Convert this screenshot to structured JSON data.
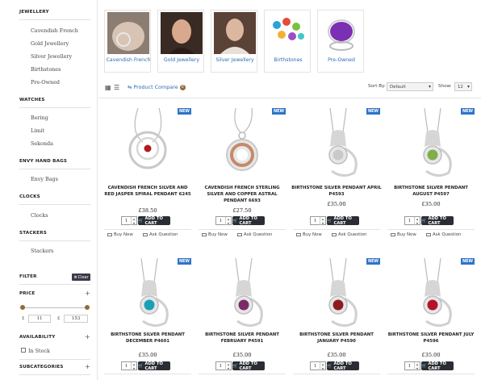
{
  "sidebar": {
    "jewellery": {
      "heading": "JEWELLERY",
      "items": [
        "Cavendish French",
        "Gold Jewellery",
        "Silver Jewellery",
        "Birthstones",
        "Pre-Owned"
      ]
    },
    "watches": {
      "heading": "WATCHES",
      "items": [
        "Bering",
        "Limit",
        "Sekonda"
      ]
    },
    "envy": {
      "heading": "ENVY HAND BAGS",
      "items": [
        "Envy Bags"
      ]
    },
    "clocks": {
      "heading": "CLOCKS",
      "items": [
        "Clocks"
      ]
    },
    "stackers": {
      "heading": "STACKERS",
      "items": [
        "Stackers"
      ]
    },
    "filter": {
      "heading": "FILTER",
      "clear": "Clear"
    },
    "price": {
      "heading": "PRICE",
      "currency": "£",
      "min": "11",
      "max": "153"
    },
    "availability": {
      "heading": "AVAILABILITY",
      "option": "In Stock"
    },
    "subcategories": {
      "heading": "SUBCATEGORIES"
    }
  },
  "categories": [
    "Cavendish French",
    "Gold Jewellery",
    "Silver Jewellery",
    "Birthstones",
    "Pre-Owned"
  ],
  "toolbar": {
    "compare": "Product Compare",
    "compare_count": "0",
    "sort_label": "Sort By:",
    "sort_value": "Default",
    "show_label": "Show:",
    "show_value": "12"
  },
  "labels": {
    "new": "NEW",
    "add_to_cart": "ADD TO CART",
    "buy_now": "Buy Now",
    "ask_question": "Ask Question",
    "qty": "1"
  },
  "products": [
    {
      "name": "CAVENDISH FRENCH SILVER AND RED JASPER SPIRAL PENDANT 6245",
      "price": "£38.50",
      "stone": "#b01b22"
    },
    {
      "name": "CAVENDISH FRENCH STERLING SILVER AND COPPER ASTRAL PENDANT 6693",
      "price": "£27.50",
      "stone": "#c58a6a"
    },
    {
      "name": "BIRTHSTONE SILVER PENDANT APRIL P4593",
      "price": "£35.00",
      "stone": "#c9c9c9"
    },
    {
      "name": "BIRTHSTONE SILVER PENDANT AUGUST P4597",
      "price": "£35.00",
      "stone": "#7fae4a"
    },
    {
      "name": "BIRTHSTONE SILVER PENDANT DECEMBER P4601",
      "price": "£35.00",
      "stone": "#1aa0b5"
    },
    {
      "name": "BIRTHSTONE SILVER PENDANT FEBRUARY P4591",
      "price": "£35.00",
      "stone": "#7a2a66"
    },
    {
      "name": "BIRTHSTONE SILVER PENDANT JANUARY P4590",
      "price": "£35.00",
      "stone": "#8a1c20"
    },
    {
      "name": "BIRTHSTONE SILVER PENDANT JULY P4596",
      "price": "£35.00",
      "stone": "#b3122a"
    }
  ]
}
